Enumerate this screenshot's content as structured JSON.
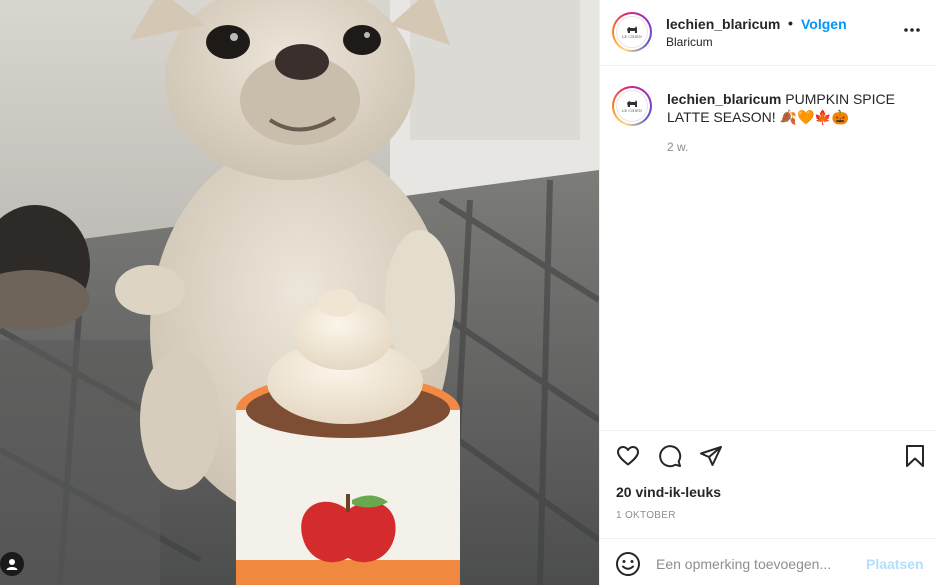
{
  "post": {
    "username": "lechien_blaricum",
    "follow_separator": "•",
    "follow_label": "Volgen",
    "location": "Blaricum",
    "more_label": "•••",
    "avatar_text": "LE CHIEN"
  },
  "caption": {
    "username": "lechien_blaricum",
    "text": " PUMPKIN SPICE LATTE SEASON! 🍂🧡🍁🎃",
    "time": "2 w."
  },
  "actions": {
    "like_icon": "heart-icon",
    "comment_icon": "speech-bubble-icon",
    "share_icon": "paper-plane-icon",
    "save_icon": "bookmark-icon"
  },
  "stats": {
    "likes": "20 vind-ik-leuks",
    "date": "1 OKTOBER"
  },
  "comment": {
    "placeholder": "Een opmerking toevoegen...",
    "post_label": "Plaatsen",
    "emoji_icon": "smiley-icon"
  },
  "colors": {
    "accent": "#0095f6",
    "post_disabled": "#b2dffc",
    "muted": "#8e8e8e"
  }
}
